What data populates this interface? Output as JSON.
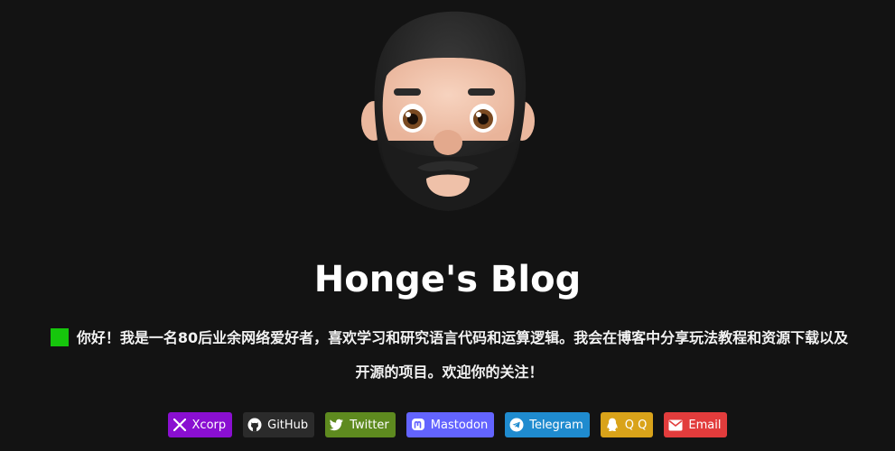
{
  "profile": {
    "avatar_icon": "bearded-man-emoji-icon",
    "title": "Honge's Blog",
    "intro": "你好！我是一名80后业余网络爱好者，喜欢学习和研究语言代码和运算逻辑。我会在博客中分享玩法教程和资源下载以及开源的项目。欢迎你的关注！"
  },
  "colors": {
    "background": "#131313",
    "square": "#16c60c"
  },
  "socials": [
    {
      "label": "Xcorp",
      "icon": "x-icon",
      "color": "#8a0fd1"
    },
    {
      "label": "GitHub",
      "icon": "github-icon",
      "color": "#2b2b2b"
    },
    {
      "label": "Twitter",
      "icon": "twitter-bird-icon",
      "color": "#5e8a1f"
    },
    {
      "label": "Mastodon",
      "icon": "mastodon-icon",
      "color": "#6364ff"
    },
    {
      "label": "Telegram",
      "icon": "telegram-icon",
      "color": "#1f8bcf"
    },
    {
      "label": "Q Q",
      "icon": "qq-penguin-icon",
      "color": "#d9a31a"
    },
    {
      "label": "Email",
      "icon": "envelope-icon",
      "color": "#e23c3c"
    }
  ]
}
